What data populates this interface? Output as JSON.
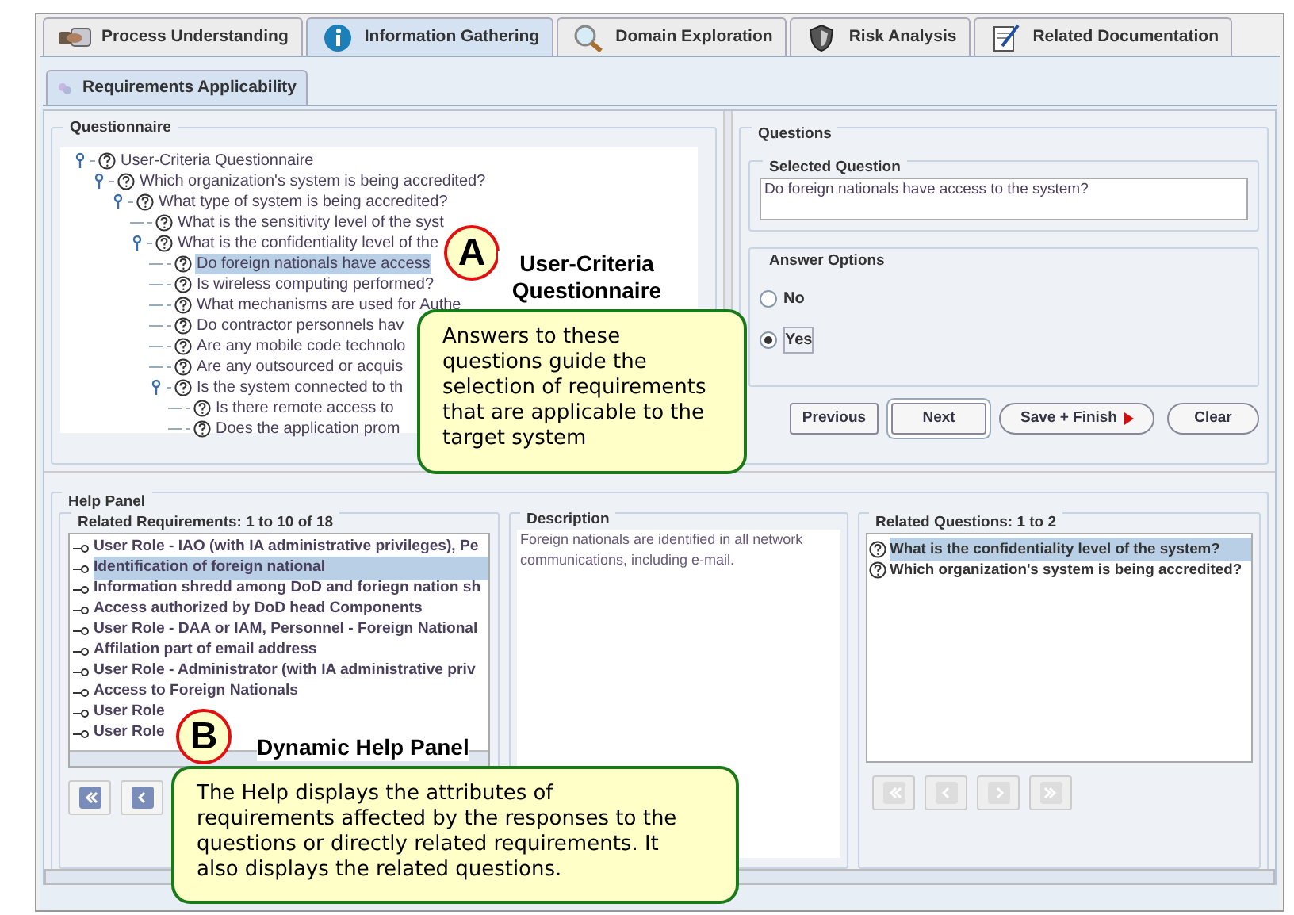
{
  "tabs": [
    {
      "label": "Process Understanding",
      "selected": false
    },
    {
      "label": "Information Gathering",
      "selected": true
    },
    {
      "label": "Domain Exploration",
      "selected": false
    },
    {
      "label": "Risk Analysis",
      "selected": false
    },
    {
      "label": "Related Documentation",
      "selected": false
    }
  ],
  "subtabs": [
    {
      "label": "Requirements Applicability",
      "selected": true
    }
  ],
  "questionnaire": {
    "title": "Questionnaire",
    "tree": [
      {
        "label": "User-Criteria Questionnaire",
        "selected": false,
        "children": [
          {
            "label": "Which organization's system is being accredited?",
            "selected": false,
            "children": [
              {
                "label": "What type of system is being accredited?",
                "selected": false,
                "children": [
                  {
                    "label": "What is the sensitivity level of the syst",
                    "selected": false
                  },
                  {
                    "label": "What is the confidentiality level of the",
                    "selected": false,
                    "children": [
                      {
                        "label": "Do foreign nationals have access",
                        "selected": true
                      },
                      {
                        "label": "Is wireless computing performed?",
                        "selected": false
                      },
                      {
                        "label": "What mechanisms are used for Authe",
                        "selected": false
                      },
                      {
                        "label": "Do contractor personnels hav",
                        "selected": false
                      },
                      {
                        "label": "Are any mobile code technolo",
                        "selected": false
                      },
                      {
                        "label": "Are any outsourced or acquis",
                        "selected": false
                      },
                      {
                        "label": "Is the system connected to th",
                        "selected": false,
                        "children": [
                          {
                            "label": "Is there remote access to",
                            "selected": false
                          },
                          {
                            "label": "Does the application prom",
                            "selected": false
                          }
                        ]
                      }
                    ]
                  }
                ]
              }
            ]
          }
        ]
      }
    ]
  },
  "questions": {
    "title": "Questions",
    "selected_question": {
      "title": "Selected Question",
      "value": "Do foreign nationals have access to the system?"
    },
    "answer_options": {
      "title": "Answer Options",
      "options": [
        {
          "label": "No",
          "selected": false
        },
        {
          "label": "Yes",
          "selected": true
        }
      ]
    },
    "buttons": [
      {
        "label": "Previous",
        "kind": "plain"
      },
      {
        "label": "Next",
        "kind": "default"
      },
      {
        "label": "Save + Finish",
        "kind": "arrow"
      },
      {
        "label": "Clear",
        "kind": "pill"
      }
    ]
  },
  "help_panel": {
    "title": "Help Panel",
    "related_requirements": {
      "title": "Related Requirements: 1 to 10 of 18",
      "items": [
        {
          "label": "User Role - IAO (with IA administrative privileges), Pe",
          "selected": false
        },
        {
          "label": "Identification of foreign national",
          "selected": true
        },
        {
          "label": "Information shredd among DoD and foriegn nation sh",
          "selected": false
        },
        {
          "label": "Access authorized by DoD head Components",
          "selected": false
        },
        {
          "label": "User Role - DAA or IAM, Personnel - Foreign National",
          "selected": false
        },
        {
          "label": "Affilation part of email address",
          "selected": false
        },
        {
          "label": "User Role - Administrator (with IA administrative priv",
          "selected": false
        },
        {
          "label": "Access to Foreign Nationals",
          "selected": false
        },
        {
          "label": "User Role",
          "selected": false
        },
        {
          "label": "User Role",
          "selected": false
        }
      ]
    },
    "description": {
      "title": "Description",
      "text": "Foreign nationals are identified in all network communications, including e-mail."
    },
    "related_questions": {
      "title": "Related Questions: 1 to 2",
      "items": [
        {
          "label": "What is the confidentiality level of the system?",
          "selected": true
        },
        {
          "label": "Which organization's system is being accredited?",
          "selected": false
        }
      ]
    }
  },
  "callouts": [
    {
      "letter": "A",
      "title": "User-Criteria Questionnaire",
      "text": "Answers to these questions guide the selection of requirements that are applicable to the target system"
    },
    {
      "letter": "B",
      "title": "Dynamic Help Panel",
      "text": "The Help displays the attributes of requirements affected by the responses to the questions or directly related requirements. It also displays the related questions."
    }
  ]
}
